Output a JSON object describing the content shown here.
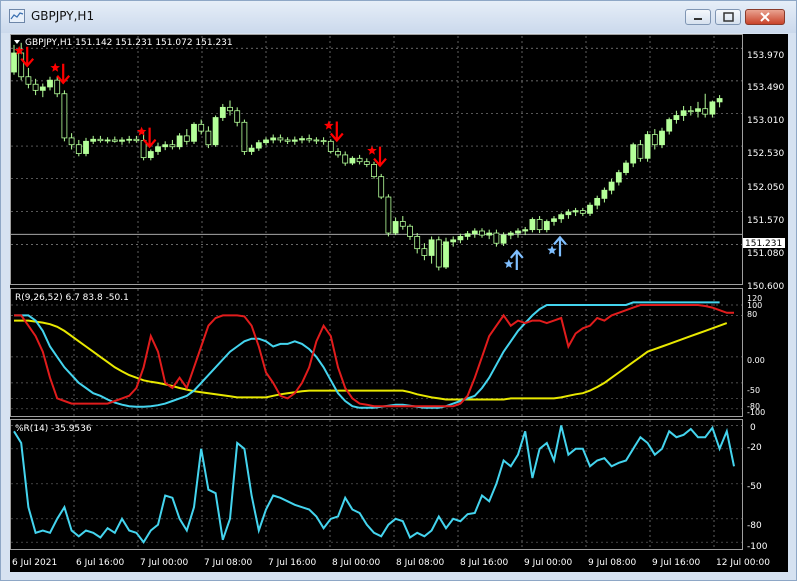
{
  "window": {
    "title": "GBPJPY,H1",
    "buttons": [
      "minimize",
      "maximize",
      "close"
    ]
  },
  "colors": {
    "background": "#000000",
    "grid": "#8a8a8a",
    "bull_candle": "#b4ff99",
    "bear_candle": "#000000",
    "sell_signal": "#ff0000",
    "buy_signal": "#7fbfff",
    "rsi_red": "#e11c1c",
    "cyan": "#44d4ee",
    "yellow": "#e8e800",
    "label_text": "#ffffff"
  },
  "price_panel": {
    "header": "GBPJPY,H1  151.142 151.231 151.072 151.231",
    "price_labels": [
      "153.970",
      "153.490",
      "153.010",
      "152.530",
      "152.050",
      "151.570",
      "151.080",
      "150.600"
    ],
    "current_price": "151.231"
  },
  "osc_panel": {
    "header": "R(9,26,52) 6.7 83.8 -50.1",
    "level_labels": [
      "120",
      "100",
      "80",
      "0.00",
      "-50",
      "-80",
      "-100"
    ]
  },
  "wpr_panel": {
    "header": "%R(14) -35.9536",
    "level_labels": [
      "0",
      "-20",
      "-50",
      "-80",
      "-100"
    ]
  },
  "time_labels": [
    "6 Jul 2021",
    "6 Jul 16:00",
    "7 Jul 00:00",
    "7 Jul 08:00",
    "7 Jul 16:00",
    "8 Jul 00:00",
    "8 Jul 08:00",
    "8 Jul 16:00",
    "9 Jul 00:00",
    "9 Jul 08:00",
    "9 Jul 16:00",
    "12 Jul 00:00"
  ],
  "chart_data": {
    "type": "candlestick",
    "symbol": "GBPJPY",
    "timeframe": "H1",
    "price_range": [
      150.5,
      154.15
    ],
    "candles": [
      {
        "o": 153.62,
        "h": 154.02,
        "l": 153.58,
        "c": 153.9
      },
      {
        "o": 153.9,
        "h": 154.05,
        "l": 153.5,
        "c": 153.55
      },
      {
        "o": 153.55,
        "h": 153.68,
        "l": 153.38,
        "c": 153.44
      },
      {
        "o": 153.44,
        "h": 153.52,
        "l": 153.28,
        "c": 153.35
      },
      {
        "o": 153.35,
        "h": 153.45,
        "l": 153.25,
        "c": 153.4
      },
      {
        "o": 153.4,
        "h": 153.55,
        "l": 153.35,
        "c": 153.5
      },
      {
        "o": 153.5,
        "h": 153.55,
        "l": 153.25,
        "c": 153.3
      },
      {
        "o": 153.3,
        "h": 153.35,
        "l": 152.6,
        "c": 152.65
      },
      {
        "o": 152.65,
        "h": 152.72,
        "l": 152.48,
        "c": 152.55
      },
      {
        "o": 152.55,
        "h": 152.62,
        "l": 152.38,
        "c": 152.42
      },
      {
        "o": 152.42,
        "h": 152.65,
        "l": 152.38,
        "c": 152.6
      },
      {
        "o": 152.6,
        "h": 152.68,
        "l": 152.56,
        "c": 152.63
      },
      {
        "o": 152.63,
        "h": 152.68,
        "l": 152.58,
        "c": 152.61
      },
      {
        "o": 152.61,
        "h": 152.66,
        "l": 152.57,
        "c": 152.62
      },
      {
        "o": 152.62,
        "h": 152.67,
        "l": 152.58,
        "c": 152.6
      },
      {
        "o": 152.6,
        "h": 152.66,
        "l": 152.55,
        "c": 152.62
      },
      {
        "o": 152.62,
        "h": 152.68,
        "l": 152.57,
        "c": 152.63
      },
      {
        "o": 152.63,
        "h": 152.68,
        "l": 152.58,
        "c": 152.61
      },
      {
        "o": 152.61,
        "h": 152.75,
        "l": 152.32,
        "c": 152.36
      },
      {
        "o": 152.36,
        "h": 152.48,
        "l": 152.32,
        "c": 152.45
      },
      {
        "o": 152.45,
        "h": 152.58,
        "l": 152.4,
        "c": 152.52
      },
      {
        "o": 152.52,
        "h": 152.6,
        "l": 152.47,
        "c": 152.55
      },
      {
        "o": 152.55,
        "h": 152.62,
        "l": 152.48,
        "c": 152.52
      },
      {
        "o": 152.52,
        "h": 152.72,
        "l": 152.48,
        "c": 152.68
      },
      {
        "o": 152.68,
        "h": 152.78,
        "l": 152.55,
        "c": 152.6
      },
      {
        "o": 152.6,
        "h": 152.88,
        "l": 152.56,
        "c": 152.85
      },
      {
        "o": 152.85,
        "h": 152.92,
        "l": 152.7,
        "c": 152.75
      },
      {
        "o": 152.75,
        "h": 152.82,
        "l": 152.5,
        "c": 152.55
      },
      {
        "o": 152.55,
        "h": 152.98,
        "l": 152.52,
        "c": 152.95
      },
      {
        "o": 152.95,
        "h": 153.15,
        "l": 152.9,
        "c": 153.1
      },
      {
        "o": 153.1,
        "h": 153.2,
        "l": 152.98,
        "c": 153.05
      },
      {
        "o": 153.05,
        "h": 153.1,
        "l": 152.82,
        "c": 152.88
      },
      {
        "o": 152.88,
        "h": 152.92,
        "l": 152.4,
        "c": 152.45
      },
      {
        "o": 152.45,
        "h": 152.55,
        "l": 152.4,
        "c": 152.5
      },
      {
        "o": 152.5,
        "h": 152.62,
        "l": 152.46,
        "c": 152.58
      },
      {
        "o": 152.58,
        "h": 152.66,
        "l": 152.54,
        "c": 152.62
      },
      {
        "o": 152.62,
        "h": 152.7,
        "l": 152.57,
        "c": 152.65
      },
      {
        "o": 152.65,
        "h": 152.7,
        "l": 152.58,
        "c": 152.62
      },
      {
        "o": 152.62,
        "h": 152.66,
        "l": 152.56,
        "c": 152.6
      },
      {
        "o": 152.6,
        "h": 152.67,
        "l": 152.55,
        "c": 152.62
      },
      {
        "o": 152.62,
        "h": 152.68,
        "l": 152.57,
        "c": 152.64
      },
      {
        "o": 152.64,
        "h": 152.7,
        "l": 152.58,
        "c": 152.62
      },
      {
        "o": 152.62,
        "h": 152.66,
        "l": 152.56,
        "c": 152.61
      },
      {
        "o": 152.61,
        "h": 152.66,
        "l": 152.55,
        "c": 152.6
      },
      {
        "o": 152.6,
        "h": 152.63,
        "l": 152.42,
        "c": 152.45
      },
      {
        "o": 152.45,
        "h": 152.5,
        "l": 152.36,
        "c": 152.4
      },
      {
        "o": 152.4,
        "h": 152.45,
        "l": 152.24,
        "c": 152.28
      },
      {
        "o": 152.28,
        "h": 152.38,
        "l": 152.25,
        "c": 152.35
      },
      {
        "o": 152.35,
        "h": 152.4,
        "l": 152.26,
        "c": 152.3
      },
      {
        "o": 152.3,
        "h": 152.35,
        "l": 152.22,
        "c": 152.26
      },
      {
        "o": 152.26,
        "h": 152.3,
        "l": 152.05,
        "c": 152.08
      },
      {
        "o": 152.08,
        "h": 152.12,
        "l": 151.75,
        "c": 151.78
      },
      {
        "o": 151.78,
        "h": 151.82,
        "l": 151.2,
        "c": 151.25
      },
      {
        "o": 151.25,
        "h": 151.48,
        "l": 151.22,
        "c": 151.42
      },
      {
        "o": 151.42,
        "h": 151.5,
        "l": 151.3,
        "c": 151.35
      },
      {
        "o": 151.35,
        "h": 151.38,
        "l": 151.15,
        "c": 151.2
      },
      {
        "o": 151.2,
        "h": 151.25,
        "l": 150.95,
        "c": 151.02
      },
      {
        "o": 151.02,
        "h": 151.1,
        "l": 150.85,
        "c": 150.92
      },
      {
        "o": 150.92,
        "h": 151.2,
        "l": 150.8,
        "c": 151.15
      },
      {
        "o": 151.15,
        "h": 151.2,
        "l": 150.7,
        "c": 150.75
      },
      {
        "o": 150.75,
        "h": 151.18,
        "l": 150.72,
        "c": 151.12
      },
      {
        "o": 151.12,
        "h": 151.2,
        "l": 151.05,
        "c": 151.15
      },
      {
        "o": 151.15,
        "h": 151.24,
        "l": 151.1,
        "c": 151.2
      },
      {
        "o": 151.2,
        "h": 151.28,
        "l": 151.15,
        "c": 151.24
      },
      {
        "o": 151.24,
        "h": 151.32,
        "l": 151.18,
        "c": 151.28
      },
      {
        "o": 151.28,
        "h": 151.32,
        "l": 151.18,
        "c": 151.22
      },
      {
        "o": 151.22,
        "h": 151.3,
        "l": 151.16,
        "c": 151.25
      },
      {
        "o": 151.25,
        "h": 151.3,
        "l": 151.05,
        "c": 151.1
      },
      {
        "o": 151.1,
        "h": 151.26,
        "l": 151.06,
        "c": 151.22
      },
      {
        "o": 151.22,
        "h": 151.28,
        "l": 151.16,
        "c": 151.25
      },
      {
        "o": 151.25,
        "h": 151.32,
        "l": 151.18,
        "c": 151.28
      },
      {
        "o": 151.28,
        "h": 151.34,
        "l": 151.22,
        "c": 151.3
      },
      {
        "o": 151.3,
        "h": 151.48,
        "l": 151.26,
        "c": 151.45
      },
      {
        "o": 151.45,
        "h": 151.5,
        "l": 151.25,
        "c": 151.3
      },
      {
        "o": 151.3,
        "h": 151.45,
        "l": 151.26,
        "c": 151.42
      },
      {
        "o": 151.42,
        "h": 151.5,
        "l": 151.36,
        "c": 151.46
      },
      {
        "o": 151.46,
        "h": 151.55,
        "l": 151.4,
        "c": 151.52
      },
      {
        "o": 151.52,
        "h": 151.6,
        "l": 151.46,
        "c": 151.56
      },
      {
        "o": 151.56,
        "h": 151.62,
        "l": 151.5,
        "c": 151.58
      },
      {
        "o": 151.58,
        "h": 151.62,
        "l": 151.5,
        "c": 151.54
      },
      {
        "o": 151.54,
        "h": 151.7,
        "l": 151.5,
        "c": 151.66
      },
      {
        "o": 151.66,
        "h": 151.8,
        "l": 151.6,
        "c": 151.76
      },
      {
        "o": 151.76,
        "h": 151.92,
        "l": 151.7,
        "c": 151.88
      },
      {
        "o": 151.88,
        "h": 152.05,
        "l": 151.82,
        "c": 152.0
      },
      {
        "o": 152.0,
        "h": 152.18,
        "l": 151.95,
        "c": 152.14
      },
      {
        "o": 152.14,
        "h": 152.32,
        "l": 152.1,
        "c": 152.28
      },
      {
        "o": 152.28,
        "h": 152.58,
        "l": 152.22,
        "c": 152.55
      },
      {
        "o": 152.55,
        "h": 152.62,
        "l": 152.3,
        "c": 152.35
      },
      {
        "o": 152.35,
        "h": 152.75,
        "l": 152.3,
        "c": 152.7
      },
      {
        "o": 152.7,
        "h": 152.78,
        "l": 152.48,
        "c": 152.55
      },
      {
        "o": 152.55,
        "h": 152.8,
        "l": 152.5,
        "c": 152.75
      },
      {
        "o": 152.75,
        "h": 152.95,
        "l": 152.7,
        "c": 152.92
      },
      {
        "o": 152.92,
        "h": 153.05,
        "l": 152.86,
        "c": 152.98
      },
      {
        "o": 152.98,
        "h": 153.12,
        "l": 152.9,
        "c": 153.05
      },
      {
        "o": 153.05,
        "h": 153.12,
        "l": 152.98,
        "c": 153.04
      },
      {
        "o": 153.04,
        "h": 153.18,
        "l": 152.95,
        "c": 153.08
      },
      {
        "o": 153.08,
        "h": 153.3,
        "l": 152.95,
        "c": 153.0
      },
      {
        "o": 153.0,
        "h": 153.2,
        "l": 152.95,
        "c": 153.18
      },
      {
        "o": 153.18,
        "h": 153.28,
        "l": 153.1,
        "c": 153.23
      }
    ],
    "sell_signals": [
      {
        "index": 1,
        "price": 153.55
      },
      {
        "index": 6,
        "price": 153.3
      },
      {
        "index": 18,
        "price": 152.36
      },
      {
        "index": 44,
        "price": 152.45
      },
      {
        "index": 50,
        "price": 152.08
      }
    ],
    "buy_signals": [
      {
        "index": 69,
        "price": 151.06
      },
      {
        "index": 75,
        "price": 151.26
      }
    ],
    "oscillator": {
      "range": [
        -110,
        125
      ],
      "levels": [
        100,
        80,
        0,
        -50,
        -80,
        -100
      ],
      "red": [
        80,
        80,
        60,
        40,
        10,
        -40,
        -80,
        -85,
        -90,
        -90,
        -90,
        -90,
        -90,
        -90,
        -85,
        -80,
        -75,
        -60,
        -20,
        40,
        10,
        -50,
        -60,
        -40,
        -60,
        -20,
        20,
        60,
        75,
        80,
        80,
        80,
        78,
        60,
        20,
        -30,
        -50,
        -75,
        -80,
        -70,
        -50,
        -20,
        30,
        60,
        40,
        -20,
        -60,
        -80,
        -90,
        -92,
        -95,
        -95,
        -95,
        -95,
        -95,
        -95,
        -95,
        -95,
        -95,
        -95,
        -95,
        -95,
        -90,
        -75,
        -40,
        0,
        40,
        60,
        80,
        60,
        70,
        65,
        70,
        70,
        65,
        70,
        75,
        20,
        45,
        55,
        60,
        75,
        70,
        80,
        85,
        90,
        95,
        100,
        100,
        100,
        100,
        100,
        100,
        100,
        100,
        100,
        98,
        95,
        90,
        85,
        85
      ],
      "cyan": [
        80,
        80,
        80,
        70,
        50,
        20,
        0,
        -20,
        -35,
        -50,
        -60,
        -70,
        -75,
        -82,
        -88,
        -92,
        -95,
        -96,
        -96,
        -95,
        -93,
        -90,
        -85,
        -80,
        -75,
        -65,
        -50,
        -35,
        -20,
        -5,
        10,
        20,
        30,
        35,
        35,
        30,
        20,
        25,
        25,
        30,
        25,
        15,
        0,
        -20,
        -45,
        -70,
        -85,
        -95,
        -98,
        -98,
        -98,
        -96,
        -94,
        -92,
        -92,
        -94,
        -96,
        -98,
        -98,
        -98,
        -95,
        -90,
        -85,
        -80,
        -75,
        -60,
        -40,
        -15,
        10,
        30,
        50,
        65,
        80,
        92,
        100,
        100,
        100,
        100,
        100,
        100,
        100,
        100,
        100,
        100,
        100,
        100,
        105,
        105,
        105,
        105,
        105,
        105,
        105,
        105,
        105,
        105,
        105,
        105,
        105
      ],
      "yellow": [
        70,
        70,
        70,
        68,
        66,
        63,
        58,
        50,
        40,
        30,
        20,
        10,
        0,
        -10,
        -20,
        -28,
        -35,
        -40,
        -45,
        -48,
        -50,
        -53,
        -56,
        -60,
        -63,
        -66,
        -68,
        -70,
        -72,
        -74,
        -76,
        -78,
        -78,
        -78,
        -78,
        -78,
        -75,
        -72,
        -70,
        -68,
        -66,
        -65,
        -65,
        -65,
        -65,
        -65,
        -65,
        -65,
        -65,
        -65,
        -65,
        -65,
        -65,
        -65,
        -65,
        -68,
        -72,
        -75,
        -78,
        -80,
        -82,
        -82,
        -82,
        -82,
        -82,
        -82,
        -82,
        -82,
        -82,
        -80,
        -80,
        -80,
        -80,
        -80,
        -80,
        -80,
        -78,
        -75,
        -72,
        -70,
        -65,
        -58,
        -50,
        -40,
        -30,
        -20,
        -10,
        0,
        10,
        15,
        20,
        25,
        30,
        35,
        40,
        45,
        50,
        55,
        60,
        65
      ]
    },
    "wpr": {
      "range": [
        -105,
        3
      ],
      "levels": [
        0,
        -20,
        -50,
        -80,
        -100
      ],
      "values": [
        -5,
        -15,
        -70,
        -92,
        -90,
        -92,
        -80,
        -70,
        -90,
        -95,
        -90,
        -92,
        -96,
        -88,
        -92,
        -80,
        -90,
        -92,
        -100,
        -90,
        -85,
        -60,
        -62,
        -80,
        -90,
        -70,
        -20,
        -55,
        -58,
        -98,
        -80,
        -15,
        -20,
        -60,
        -90,
        -72,
        -60,
        -62,
        -65,
        -68,
        -70,
        -72,
        -78,
        -88,
        -80,
        -78,
        -62,
        -72,
        -75,
        -85,
        -92,
        -95,
        -85,
        -80,
        -82,
        -96,
        -92,
        -95,
        -90,
        -78,
        -88,
        -80,
        -82,
        -76,
        -75,
        -60,
        -65,
        -50,
        -30,
        -35,
        -25,
        -5,
        -45,
        -20,
        -15,
        -30,
        0,
        -25,
        -20,
        -20,
        -35,
        -30,
        -28,
        -35,
        -32,
        -30,
        -20,
        -10,
        -15,
        -25,
        -20,
        -5,
        -10,
        -8,
        -3,
        -10,
        -10,
        -2,
        -20,
        -5,
        -35
      ]
    }
  }
}
